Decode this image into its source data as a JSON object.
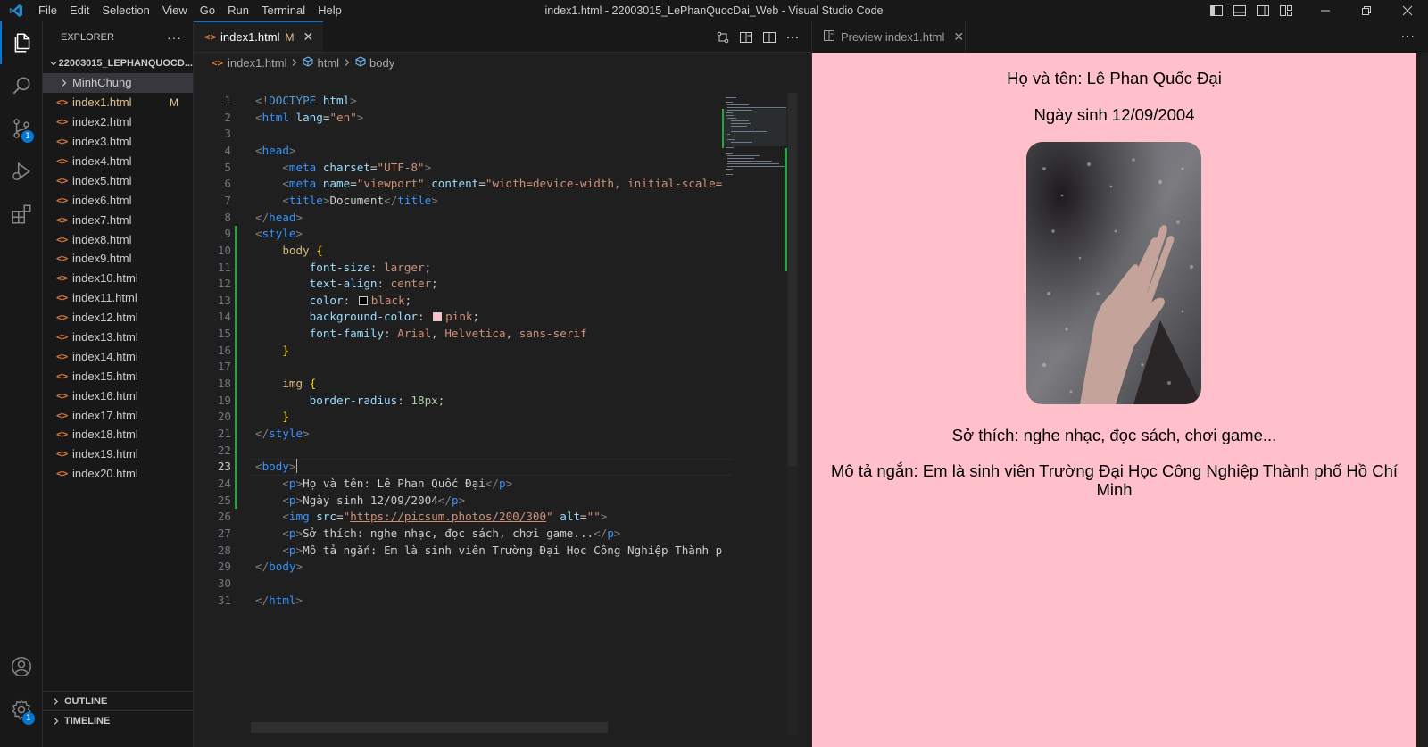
{
  "window": {
    "title": "index1.html - 22003015_LePhanQuocDai_Web - Visual Studio Code"
  },
  "menu": [
    "File",
    "Edit",
    "Selection",
    "View",
    "Go",
    "Run",
    "Terminal",
    "Help"
  ],
  "activity_bar": {
    "source_control_badge": "1",
    "settings_badge": "1"
  },
  "explorer": {
    "title": "EXPLORER",
    "more": "···",
    "folder": "22003015_LEPHANQUOCD...",
    "subfolder": "MinhChung",
    "files": [
      {
        "name": "index1.html",
        "flag": "M"
      },
      {
        "name": "index2.html",
        "flag": ""
      },
      {
        "name": "index3.html",
        "flag": ""
      },
      {
        "name": "index4.html",
        "flag": ""
      },
      {
        "name": "index5.html",
        "flag": ""
      },
      {
        "name": "index6.html",
        "flag": ""
      },
      {
        "name": "index7.html",
        "flag": ""
      },
      {
        "name": "index8.html",
        "flag": ""
      },
      {
        "name": "index9.html",
        "flag": ""
      },
      {
        "name": "index10.html",
        "flag": ""
      },
      {
        "name": "index11.html",
        "flag": ""
      },
      {
        "name": "index12.html",
        "flag": ""
      },
      {
        "name": "index13.html",
        "flag": ""
      },
      {
        "name": "index14.html",
        "flag": ""
      },
      {
        "name": "index15.html",
        "flag": ""
      },
      {
        "name": "index16.html",
        "flag": ""
      },
      {
        "name": "index17.html",
        "flag": ""
      },
      {
        "name": "index18.html",
        "flag": ""
      },
      {
        "name": "index19.html",
        "flag": ""
      },
      {
        "name": "index20.html",
        "flag": ""
      }
    ],
    "outline": "OUTLINE",
    "timeline": "TIMELINE"
  },
  "editor": {
    "tab": {
      "label": "index1.html",
      "mark": "M",
      "close": "✕"
    },
    "breadcrumb": [
      "index1.html",
      "html",
      "body"
    ],
    "code_lines": [
      [
        {
          "t": "<!",
          "c": "t-punct"
        },
        {
          "t": "DOCTYPE",
          "c": "t-doctype"
        },
        {
          "t": " html",
          "c": "t-attr"
        },
        {
          "t": ">",
          "c": "t-punct"
        }
      ],
      [
        {
          "t": "<",
          "c": "t-punct"
        },
        {
          "t": "html",
          "c": "t-tag"
        },
        {
          "t": " lang",
          "c": "t-attr"
        },
        {
          "t": "=",
          "c": "t-text"
        },
        {
          "t": "\"en\"",
          "c": "t-str"
        },
        {
          "t": ">",
          "c": "t-punct"
        }
      ],
      [],
      [
        {
          "t": "<",
          "c": "t-punct"
        },
        {
          "t": "head",
          "c": "t-tag"
        },
        {
          "t": ">",
          "c": "t-punct"
        }
      ],
      [
        {
          "t": "    <",
          "c": "t-punct"
        },
        {
          "t": "meta",
          "c": "t-tag"
        },
        {
          "t": " charset",
          "c": "t-attr"
        },
        {
          "t": "=",
          "c": "t-text"
        },
        {
          "t": "\"UTF-8\"",
          "c": "t-str"
        },
        {
          "t": ">",
          "c": "t-punct"
        }
      ],
      [
        {
          "t": "    <",
          "c": "t-punct"
        },
        {
          "t": "meta",
          "c": "t-tag"
        },
        {
          "t": " name",
          "c": "t-attr"
        },
        {
          "t": "=",
          "c": "t-text"
        },
        {
          "t": "\"viewport\"",
          "c": "t-str"
        },
        {
          "t": " content",
          "c": "t-attr"
        },
        {
          "t": "=",
          "c": "t-text"
        },
        {
          "t": "\"width=device-width, initial-scale=",
          "c": "t-str"
        }
      ],
      [
        {
          "t": "    <",
          "c": "t-punct"
        },
        {
          "t": "title",
          "c": "t-tag"
        },
        {
          "t": ">",
          "c": "t-punct"
        },
        {
          "t": "Document",
          "c": "t-text"
        },
        {
          "t": "</",
          "c": "t-punct"
        },
        {
          "t": "title",
          "c": "t-tag"
        },
        {
          "t": ">",
          "c": "t-punct"
        }
      ],
      [
        {
          "t": "</",
          "c": "t-punct"
        },
        {
          "t": "head",
          "c": "t-tag"
        },
        {
          "t": ">",
          "c": "t-punct"
        }
      ],
      [
        {
          "t": "<",
          "c": "t-punct"
        },
        {
          "t": "style",
          "c": "t-tag"
        },
        {
          "t": ">",
          "c": "t-punct"
        }
      ],
      [
        {
          "t": "    body ",
          "c": "t-sel"
        },
        {
          "t": "{",
          "c": "t-brace"
        }
      ],
      [
        {
          "t": "        font-size",
          "c": "t-prop"
        },
        {
          "t": ": ",
          "c": "t-text"
        },
        {
          "t": "larger",
          "c": "t-val"
        },
        {
          "t": ";",
          "c": "t-text"
        }
      ],
      [
        {
          "t": "        text-align",
          "c": "t-prop"
        },
        {
          "t": ": ",
          "c": "t-text"
        },
        {
          "t": "center",
          "c": "t-val"
        },
        {
          "t": ";",
          "c": "t-text"
        }
      ],
      [
        {
          "t": "        color",
          "c": "t-prop"
        },
        {
          "t": ": ",
          "c": "t-text"
        },
        {
          "t": "",
          "c": "swatch",
          "color": "#000000"
        },
        {
          "t": "black",
          "c": "t-val"
        },
        {
          "t": ";",
          "c": "t-text"
        }
      ],
      [
        {
          "t": "        background-color",
          "c": "t-prop"
        },
        {
          "t": ": ",
          "c": "t-text"
        },
        {
          "t": "",
          "c": "swatch",
          "color": "#ffc0cb"
        },
        {
          "t": "pink",
          "c": "t-val"
        },
        {
          "t": ";",
          "c": "t-text"
        }
      ],
      [
        {
          "t": "        font-family",
          "c": "t-prop"
        },
        {
          "t": ": ",
          "c": "t-text"
        },
        {
          "t": "Arial",
          "c": "t-val"
        },
        {
          "t": ", ",
          "c": "t-text"
        },
        {
          "t": "Helvetica",
          "c": "t-val"
        },
        {
          "t": ", ",
          "c": "t-text"
        },
        {
          "t": "sans-serif",
          "c": "t-val"
        }
      ],
      [
        {
          "t": "    }",
          "c": "t-brace"
        }
      ],
      [],
      [
        {
          "t": "    img ",
          "c": "t-sel"
        },
        {
          "t": "{",
          "c": "t-brace"
        }
      ],
      [
        {
          "t": "        border-radius",
          "c": "t-prop"
        },
        {
          "t": ": ",
          "c": "t-text"
        },
        {
          "t": "18px",
          "c": "t-num"
        },
        {
          "t": ";",
          "c": "t-text"
        }
      ],
      [
        {
          "t": "    }",
          "c": "t-brace"
        }
      ],
      [
        {
          "t": "</",
          "c": "t-punct"
        },
        {
          "t": "style",
          "c": "t-tag"
        },
        {
          "t": ">",
          "c": "t-punct"
        }
      ],
      [],
      [
        {
          "t": "<",
          "c": "t-punct"
        },
        {
          "t": "body",
          "c": "t-tag"
        },
        {
          "t": ">",
          "c": "t-punct"
        }
      ],
      [
        {
          "t": "    <",
          "c": "t-punct"
        },
        {
          "t": "p",
          "c": "t-tag"
        },
        {
          "t": ">",
          "c": "t-punct"
        },
        {
          "t": "Họ và tên: Lê Phan Quốc Đại",
          "c": "t-text"
        },
        {
          "t": "</",
          "c": "t-punct"
        },
        {
          "t": "p",
          "c": "t-tag"
        },
        {
          "t": ">",
          "c": "t-punct"
        }
      ],
      [
        {
          "t": "    <",
          "c": "t-punct"
        },
        {
          "t": "p",
          "c": "t-tag"
        },
        {
          "t": ">",
          "c": "t-punct"
        },
        {
          "t": "Ngày sinh 12/09/2004",
          "c": "t-text"
        },
        {
          "t": "</",
          "c": "t-punct"
        },
        {
          "t": "p",
          "c": "t-tag"
        },
        {
          "t": ">",
          "c": "t-punct"
        }
      ],
      [
        {
          "t": "    <",
          "c": "t-punct"
        },
        {
          "t": "img",
          "c": "t-tag"
        },
        {
          "t": " src",
          "c": "t-attr"
        },
        {
          "t": "=",
          "c": "t-text"
        },
        {
          "t": "\"",
          "c": "t-str"
        },
        {
          "t": "https://picsum.photos/200/300",
          "c": "t-link"
        },
        {
          "t": "\"",
          "c": "t-str"
        },
        {
          "t": " alt",
          "c": "t-attr"
        },
        {
          "t": "=",
          "c": "t-text"
        },
        {
          "t": "\"\"",
          "c": "t-str"
        },
        {
          "t": ">",
          "c": "t-punct"
        }
      ],
      [
        {
          "t": "    <",
          "c": "t-punct"
        },
        {
          "t": "p",
          "c": "t-tag"
        },
        {
          "t": ">",
          "c": "t-punct"
        },
        {
          "t": "Sở thích: nghe nhạc, đọc sách, chơi game...",
          "c": "t-text"
        },
        {
          "t": "</",
          "c": "t-punct"
        },
        {
          "t": "p",
          "c": "t-tag"
        },
        {
          "t": ">",
          "c": "t-punct"
        }
      ],
      [
        {
          "t": "    <",
          "c": "t-punct"
        },
        {
          "t": "p",
          "c": "t-tag"
        },
        {
          "t": ">",
          "c": "t-punct"
        },
        {
          "t": "Mô tả ngắn: Em là sinh viên Trường Đại Học Công Nghiệp Thành p",
          "c": "t-text"
        }
      ],
      [
        {
          "t": "</",
          "c": "t-punct"
        },
        {
          "t": "body",
          "c": "t-tag"
        },
        {
          "t": ">",
          "c": "t-punct"
        }
      ],
      [],
      [
        {
          "t": "</",
          "c": "t-punct"
        },
        {
          "t": "html",
          "c": "t-tag"
        },
        {
          "t": ">",
          "c": "t-punct"
        }
      ]
    ],
    "current_line": 23
  },
  "preview": {
    "tab_label": "Preview index1.html",
    "close": "✕",
    "more": "···",
    "name_line": "Họ và tên: Lê Phan Quốc Đại",
    "dob_line": "Ngày sinh 12/09/2004",
    "hobby_line": "Sở thích: nghe nhạc, đọc sách, chơi game...",
    "desc_line": "Mô tả ngắn: Em là sinh viên Trường Đại Học Công Nghiệp Thành phố Hồ Chí Minh",
    "background": "#ffc0cb",
    "text_color": "#000000"
  },
  "colors": {
    "accent": "#0078d4",
    "git_added": "#2ea043",
    "modified": "#e2c08d"
  }
}
